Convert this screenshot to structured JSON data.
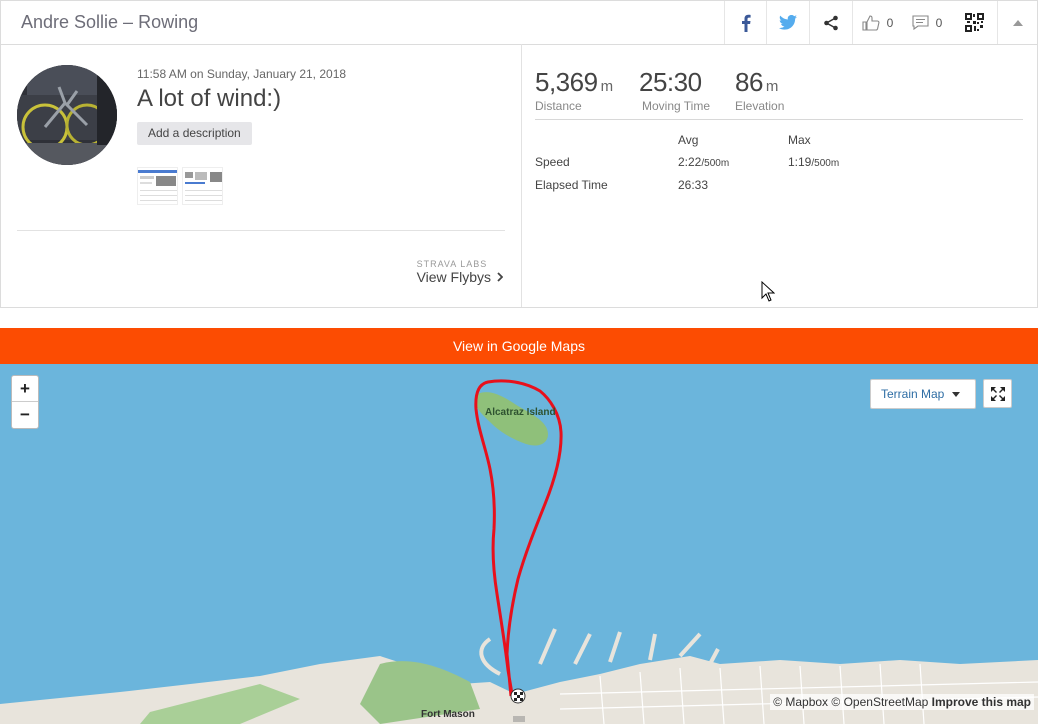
{
  "header": {
    "title": "Andre Sollie – Rowing",
    "kudos_count": "0",
    "comments_count": "0",
    "share_icons": [
      "facebook-icon",
      "twitter-icon",
      "share-icon"
    ]
  },
  "activity": {
    "date": "11:58 AM on Sunday, January 21, 2018",
    "name": "A lot of wind:)",
    "add_description": "Add a description",
    "labs_tag": "STRAVA LABS",
    "view_flybys": "View Flybys"
  },
  "stats": {
    "distance": {
      "value": "5,369",
      "unit": "m",
      "label": "Distance"
    },
    "moving_time": {
      "value": "25:30",
      "label": "Moving Time"
    },
    "elevation": {
      "value": "86",
      "unit": "m",
      "label": "Elevation"
    },
    "table": {
      "headers": [
        "Avg",
        "Max"
      ],
      "rows": [
        {
          "label": "Speed",
          "avg": "2:22",
          "avg_unit": "/500m",
          "max": "1:19",
          "max_unit": "/500m"
        },
        {
          "label": "Elapsed Time",
          "avg": "26:33",
          "max": ""
        }
      ]
    }
  },
  "map": {
    "google_maps_button": "View in Google Maps",
    "terrain_select": "Terrain Map",
    "zoom_in": "+",
    "zoom_out": "−",
    "label_alcatraz": "Alcatraz Island",
    "label_fort_mason": "Fort Mason",
    "attribution_mapbox": "© Mapbox",
    "attribution_osm": "© OpenStreetMap",
    "attribution_improve": "Improve this map",
    "route_color": "#e8101c",
    "water_color": "#6bb5dc",
    "accent_color": "#fc4c02"
  }
}
